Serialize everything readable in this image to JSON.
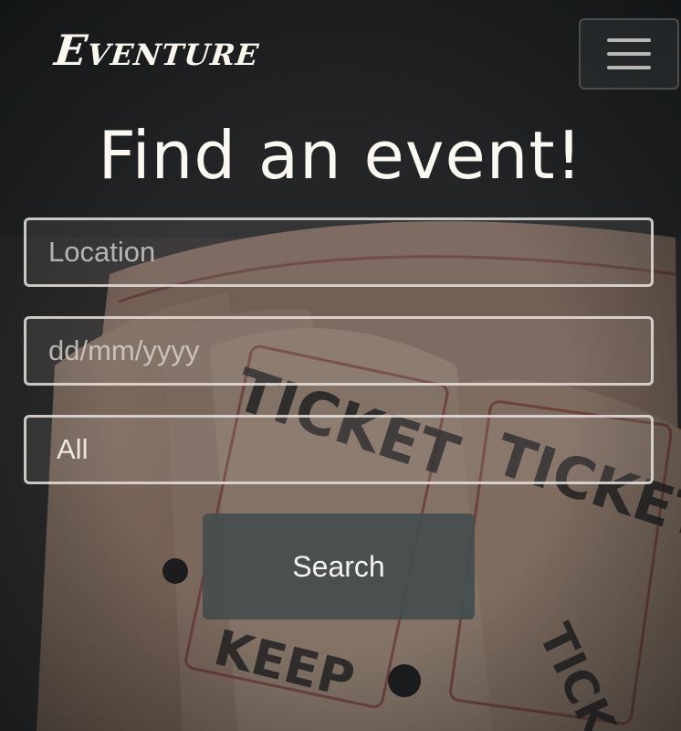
{
  "brand": {
    "name": "Eventure"
  },
  "header": {
    "menu_icon": "hamburger-menu-icon"
  },
  "main": {
    "headline": "Find an event!",
    "location_field": {
      "placeholder": "Location",
      "value": ""
    },
    "date_field": {
      "placeholder": "dd/mm/yyyy",
      "value": ""
    },
    "category_select": {
      "selected": "All"
    },
    "search_button": {
      "label": "Search"
    }
  },
  "colors": {
    "text_primary": "#fbf8f2",
    "button_bg": "#464e4c",
    "field_border": "#e6e2dc"
  }
}
